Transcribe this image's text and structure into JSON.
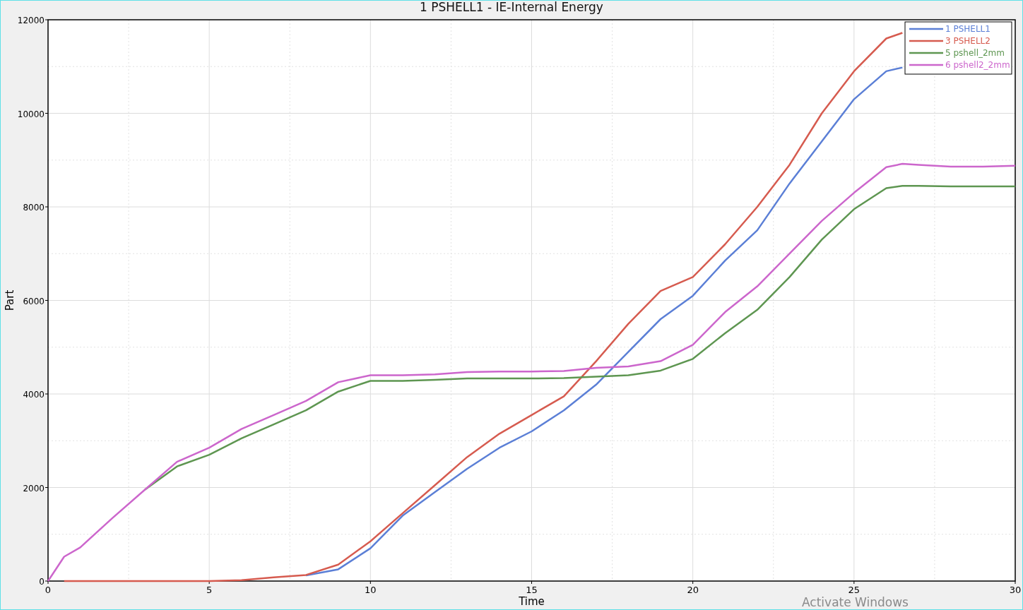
{
  "window": {
    "title": "1 PSHELL1 - IE-Internal Energy"
  },
  "plot": {
    "chart_data": {
      "type": "line",
      "xlabel": "Time",
      "ylabel": "Part",
      "x": [
        0,
        0.5,
        1,
        2,
        3,
        4,
        5,
        6,
        7,
        8,
        9,
        10,
        11,
        12,
        13,
        14,
        15,
        16,
        17,
        18,
        19,
        20,
        21,
        22,
        23,
        24,
        25,
        26,
        26.5,
        27,
        28,
        29,
        30
      ],
      "series": [
        {
          "name": "1 PSHELL1",
          "color": "#5b7fd6",
          "values": [
            null,
            null,
            null,
            null,
            null,
            null,
            null,
            null,
            null,
            120,
            250,
            700,
            1400,
            1900,
            2400,
            2850,
            3200,
            3650,
            4200,
            4900,
            5600,
            6100,
            6850,
            7500,
            8500,
            9400,
            10300,
            10900,
            10980,
            null,
            null,
            null,
            null
          ]
        },
        {
          "name": "3 PSHELL2",
          "color": "#d65b4f",
          "values": [
            null,
            0,
            0,
            0,
            0,
            0,
            0,
            20,
            80,
            130,
            350,
            850,
            1450,
            2050,
            2650,
            3150,
            3550,
            3950,
            4700,
            5500,
            6200,
            6500,
            7200,
            8000,
            8900,
            10000,
            10900,
            11600,
            11720,
            null,
            null,
            null,
            null
          ]
        },
        {
          "name": "5 pshell_2mm",
          "color": "#5e9651",
          "values": [
            null,
            null,
            null,
            null,
            1950,
            2450,
            2700,
            3050,
            3350,
            3650,
            4050,
            4280,
            4280,
            4300,
            4330,
            4330,
            4330,
            4340,
            4370,
            4400,
            4500,
            4750,
            5300,
            5800,
            6500,
            7300,
            7950,
            8400,
            8450,
            8450,
            8440,
            8440,
            8440
          ]
        },
        {
          "name": "6 pshell2_2mm",
          "color": "#cc66cc",
          "values": [
            0,
            520,
            720,
            1350,
            1950,
            2550,
            2850,
            3250,
            3550,
            3850,
            4250,
            4400,
            4400,
            4420,
            4470,
            4480,
            4480,
            4490,
            4560,
            4590,
            4700,
            5050,
            5750,
            6300,
            7000,
            7700,
            8300,
            8850,
            8920,
            8900,
            8860,
            8860,
            8880
          ]
        }
      ],
      "xlim": [
        0,
        30
      ],
      "ylim": [
        0,
        12000
      ],
      "xticks": [
        0,
        5,
        10,
        15,
        20,
        25,
        30
      ],
      "yticks": [
        0,
        2000,
        4000,
        6000,
        8000,
        10000,
        12000
      ],
      "grid": true,
      "legend": true
    }
  },
  "os_watermark": "Activate Windows"
}
